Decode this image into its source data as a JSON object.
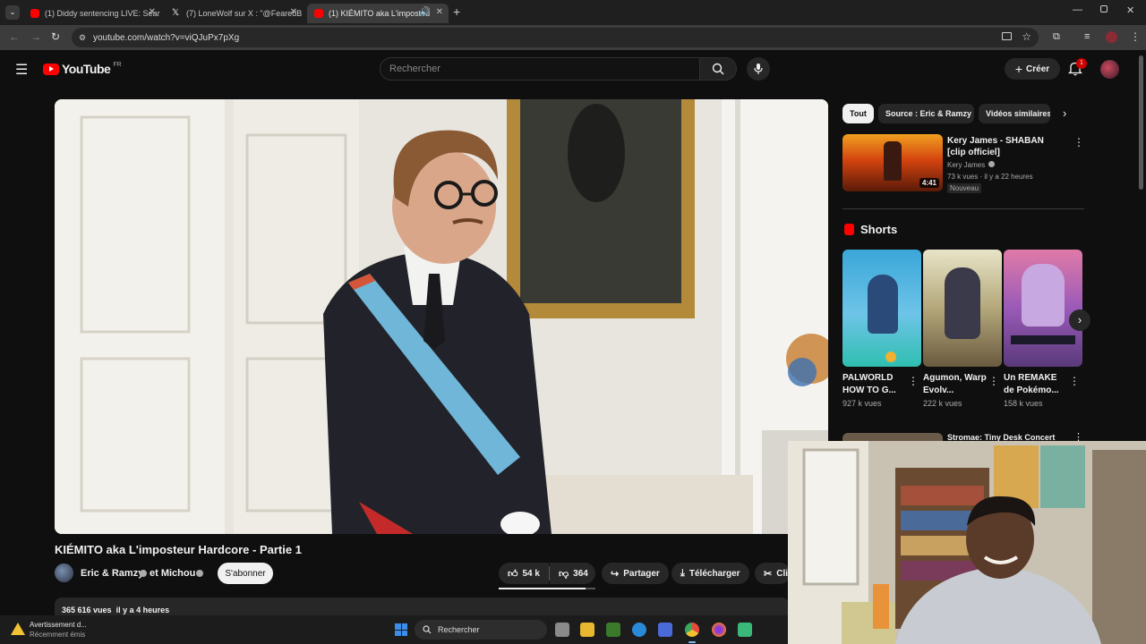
{
  "browser": {
    "tabs": [
      {
        "label": "(1) Diddy sentencing LIVE: Sear"
      },
      {
        "label": "(7) LoneWolf sur X : \"@FearedB"
      },
      {
        "label": "(1) KIÉMITO aka L'imposteu"
      }
    ],
    "url": "youtube.com/watch?v=viQJuPx7pXg"
  },
  "youtube": {
    "logo_text": "YouTube",
    "region": "FR",
    "search_placeholder": "Rechercher",
    "create_label": "Créer",
    "notification_count": "1"
  },
  "video": {
    "title": "KIÉMITO aka L'imposteur Hardcore - Partie 1",
    "channel": "Eric & Ramzy",
    "collaborator": "et Michou",
    "subscribe_label": "S'abonner",
    "likes": "54 k",
    "dislikes": "364",
    "share_label": "Partager",
    "download_label": "Télécharger",
    "clip_label": "Cli",
    "views": "365 616 vues",
    "age": "il y a 4 heures"
  },
  "sidebar": {
    "chips": [
      "Tout",
      "Source : Eric & Ramzy",
      "Vidéos similaires"
    ],
    "recommended": {
      "title": "Kery James - SHABAN  [clip officiel]",
      "channel": "Kery James",
      "meta": "73 k vues · il y a 22 heures",
      "badge": "Nouveau",
      "duration": "4:41"
    },
    "shorts_heading": "Shorts",
    "shorts": [
      {
        "title": "PALWORLD HOW TO G...",
        "views": "927 k vues"
      },
      {
        "title": "Agumon, Warp Evolv...",
        "views": "222 k vues"
      },
      {
        "title": "Un REMAKE de Pokémo...",
        "views": "158 k vues"
      }
    ],
    "partial_title": "Stromae: Tiny Desk Concert"
  },
  "taskbar": {
    "warning_title": "Avertissement d...",
    "warning_sub": "Récemment émis",
    "search_label": "Rechercher"
  },
  "colors": {
    "youtube_red": "#ff0000",
    "background": "#0f0f0f",
    "chip_bg": "#272727",
    "text_secondary": "#aaaaaa"
  }
}
